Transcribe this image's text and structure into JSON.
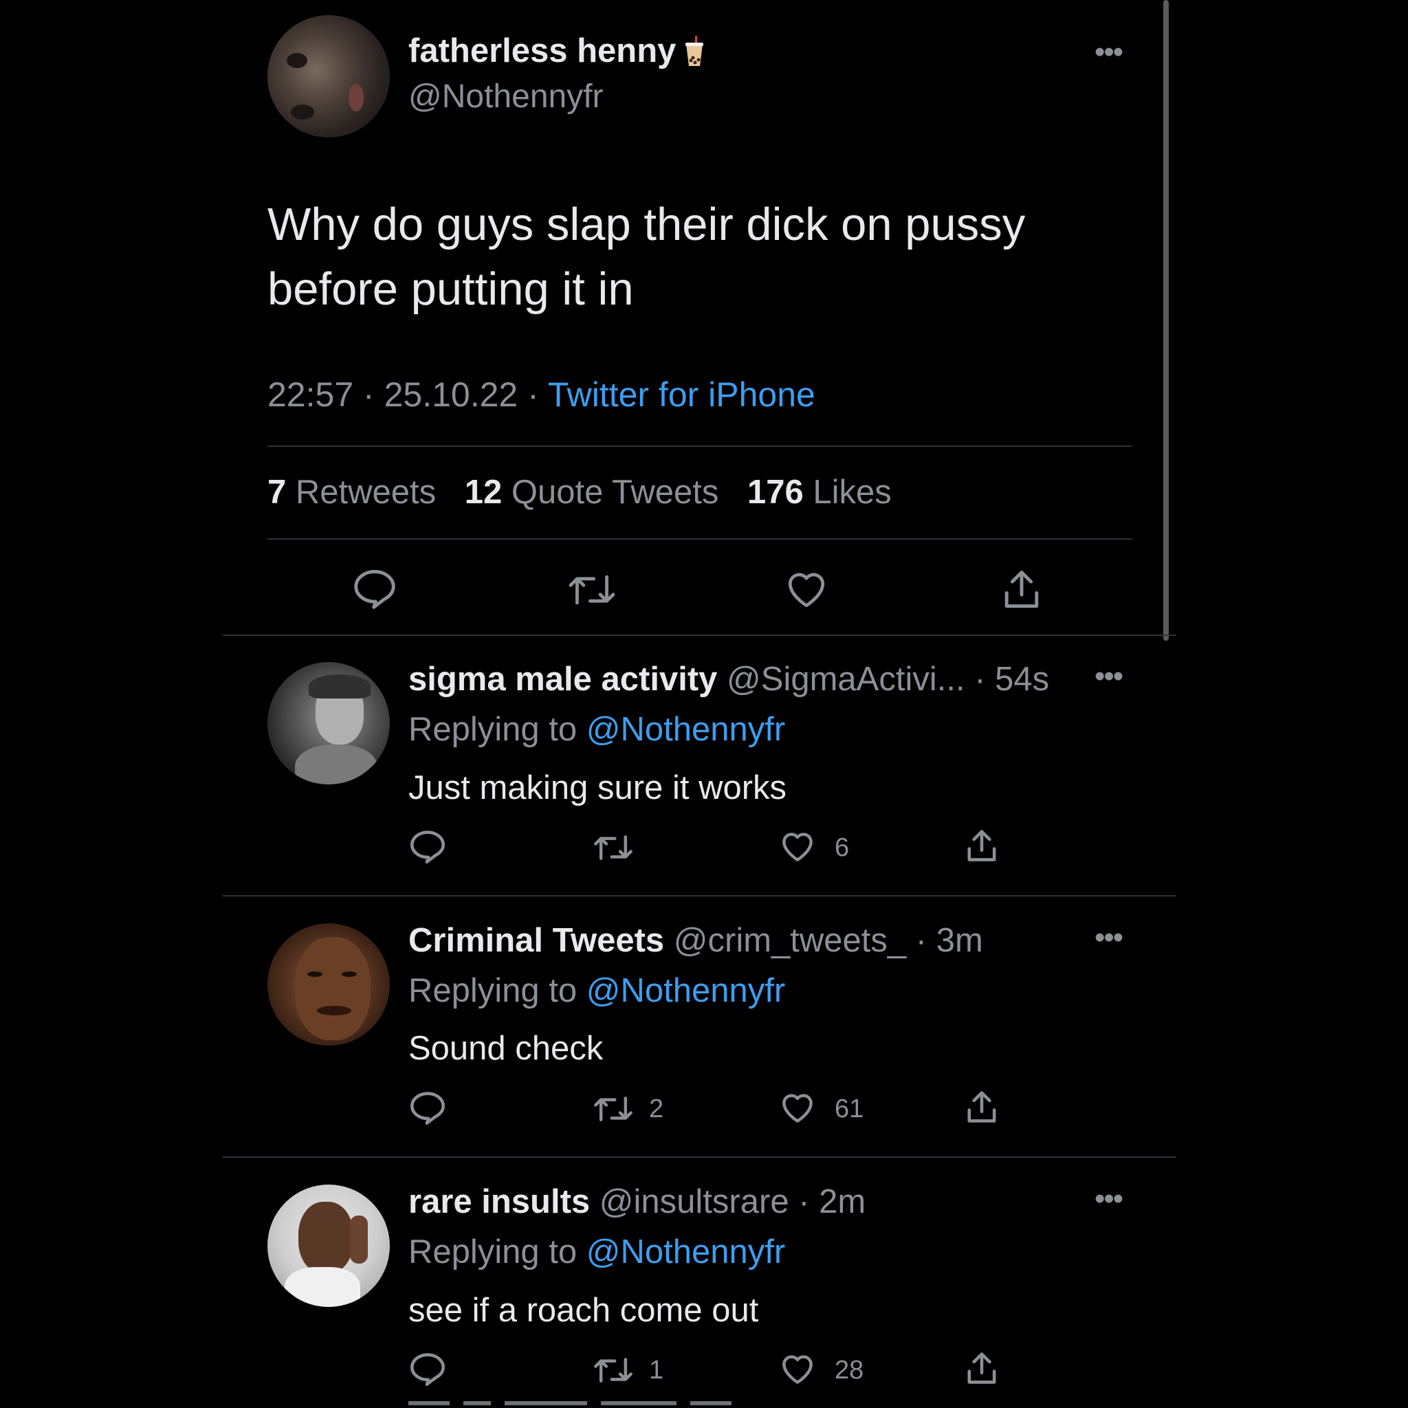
{
  "main_tweet": {
    "display_name": "fatherless henny",
    "name_emoji": "bubble-tea-emoji",
    "handle": "@Nothennyfr",
    "text": "Why do guys slap their dick on pussy before putting it in",
    "time": "22:57",
    "date": "25.10.22",
    "source": "Twitter for iPhone",
    "sep": "·",
    "stats": {
      "retweets_count": "7",
      "retweets_label": "Retweets",
      "quotes_count": "12",
      "quotes_label": "Quote Tweets",
      "likes_count": "176",
      "likes_label": "Likes"
    },
    "actions": [
      "reply-icon",
      "retweet-icon",
      "like-icon",
      "share-icon"
    ]
  },
  "replies": [
    {
      "display_name": "sigma male activity",
      "handle": "@SigmaActivi...",
      "age": "54s",
      "replying_label": "Replying to",
      "replying_to": "@Nothennyfr",
      "text": "Just making sure it works",
      "retweets": "",
      "likes": "6"
    },
    {
      "display_name": "Criminal Tweets",
      "handle": "@crim_tweets_",
      "age": "3m",
      "replying_label": "Replying to",
      "replying_to": "@Nothennyfr",
      "text": "Sound check",
      "retweets": "2",
      "likes": "61"
    },
    {
      "display_name": "rare insults",
      "handle": "@insultsrare",
      "age": "2m",
      "replying_label": "Replying to",
      "replying_to": "@Nothennyfr",
      "text": "see if a roach come out",
      "retweets": "1",
      "likes": "28"
    }
  ],
  "colors": {
    "background": "#000000",
    "text": "#e7e9ea",
    "muted": "#8b9096",
    "link": "#3d9ef0",
    "divider": "#2f3336"
  }
}
